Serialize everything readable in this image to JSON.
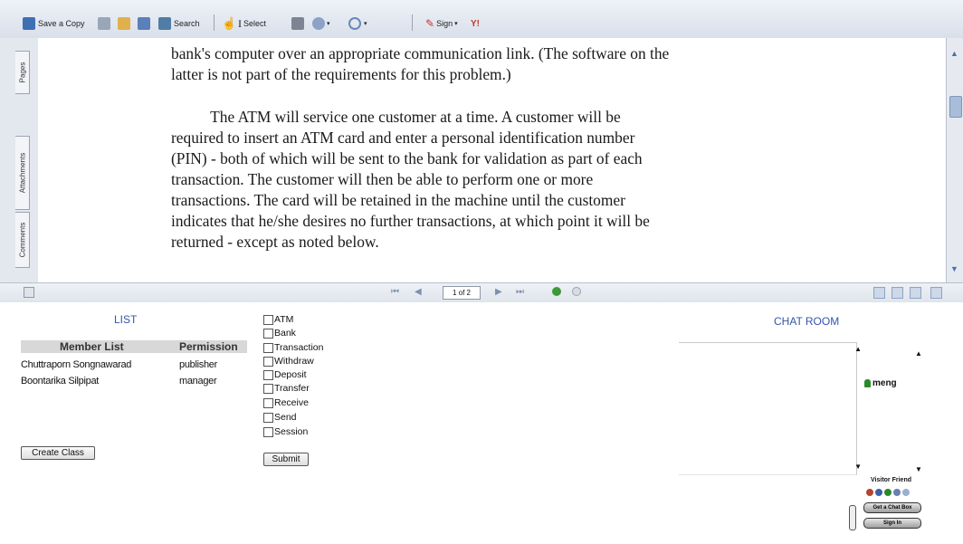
{
  "toolbar": {
    "save_copy": "Save a Copy",
    "search": "Search",
    "select": "Select",
    "sign": "Sign",
    "page_display": "1 of 2"
  },
  "side_tabs": {
    "pages": "Pages",
    "attachments": "Attachments",
    "comments": "Comments"
  },
  "document": {
    "paragraphs": [
      {
        "lines": [
          "bank's computer over an appropriate communication link. (The software on the",
          "latter is not part of the requirements for this problem.)"
        ]
      },
      {
        "lines": [
          "          The ATM will service one customer at a time. A customer will be",
          "required to insert an ATM card and enter a personal identification number",
          "(PIN) - both of which will be sent to the bank for validation as part of each",
          "transaction. The customer will then be able to perform one or more",
          "transactions. The card will be retained in the machine until the customer",
          "indicates that he/she desires no further transactions, at which point it will be",
          "returned - except as noted below."
        ]
      }
    ]
  },
  "list_panel": {
    "title": "LIST",
    "columns": [
      "Member List",
      "Permission"
    ],
    "rows": [
      {
        "name": "Chuttraporn Songnawarad",
        "permission": "publisher"
      },
      {
        "name": "Boontarika Silpipat",
        "permission": "manager"
      }
    ],
    "create_button": "Create Class"
  },
  "checklist": {
    "items": [
      "ATM",
      "Bank",
      "Transaction",
      "Withdraw",
      "Deposit",
      "Transfer",
      "Receive",
      "Send",
      "Session"
    ],
    "submit_label": "Submit"
  },
  "chat": {
    "title": "CHAT ROOM",
    "online_user": "meng",
    "visitor_label": "Visitor Friend",
    "get_chat_box": "Get a Chat Box",
    "sign_in": "Sign In"
  },
  "colors": {
    "link_blue": "#3355aa",
    "toolbar_bg": "#dfe5ee",
    "user_green": "#2a8a2a"
  }
}
